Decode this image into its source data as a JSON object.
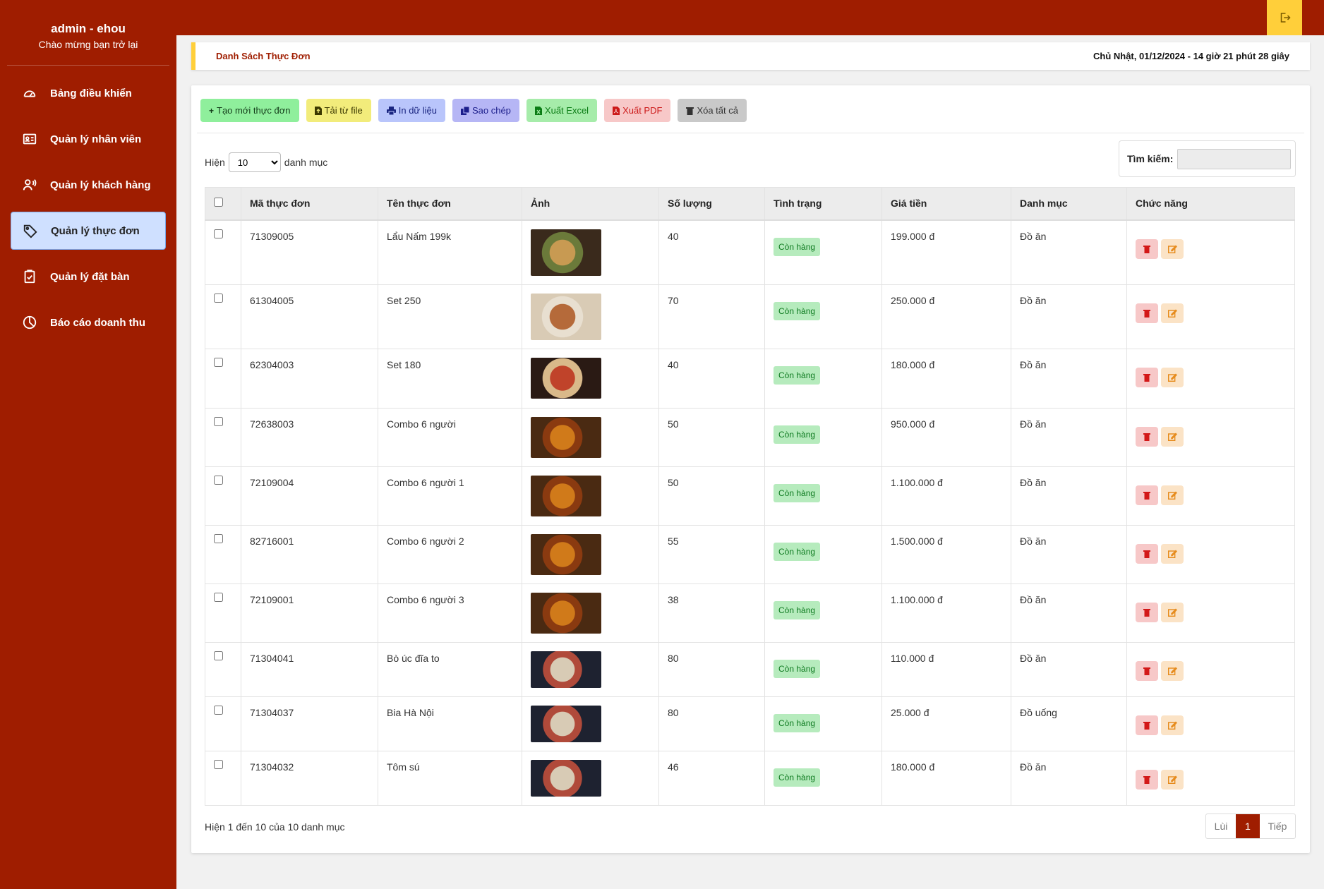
{
  "user": {
    "name": "admin - ehou",
    "welcome": "Chào mừng bạn trở lại"
  },
  "sidebar": {
    "items": [
      {
        "label": "Bảng điều khiển",
        "icon": "gauge-icon",
        "active": false
      },
      {
        "label": "Quản lý nhân viên",
        "icon": "id-card-icon",
        "active": false
      },
      {
        "label": "Quản lý khách hàng",
        "icon": "user-voice-icon",
        "active": false
      },
      {
        "label": "Quản lý thực đơn",
        "icon": "tag-icon",
        "active": true
      },
      {
        "label": "Quản lý đặt bàn",
        "icon": "clipboard-check-icon",
        "active": false
      },
      {
        "label": "Báo cáo doanh thu",
        "icon": "pie-chart-icon",
        "active": false
      }
    ]
  },
  "header": {
    "title": "Danh Sách Thực Đơn",
    "datetime": "Chủ Nhật, 01/12/2024 - 14 giờ 21 phút 28 giây",
    "logout_icon": "logout-icon"
  },
  "toolbar": {
    "create": "Tạo mới thực đơn",
    "upload": "Tải từ file",
    "print": "In dữ liệu",
    "copy": "Sao chép",
    "excel": "Xuất Excel",
    "pdf": "Xuất PDF",
    "clear": "Xóa tất cả"
  },
  "length_control": {
    "prefix": "Hiện",
    "value": "10",
    "suffix": "danh mục"
  },
  "search": {
    "label": "Tìm kiếm:",
    "value": ""
  },
  "table": {
    "columns": [
      "Mã thực đơn",
      "Tên thực đơn",
      "Ảnh",
      "Số lượng",
      "Tình trạng",
      "Giá tiền",
      "Danh mục",
      "Chức năng"
    ],
    "rows": [
      {
        "code": "71309005",
        "name": "Lẩu Nấm 199k",
        "qty": "40",
        "status": "Còn hàng",
        "price": "199.000 đ",
        "category": "Đồ ăn"
      },
      {
        "code": "61304005",
        "name": "Set 250",
        "qty": "70",
        "status": "Còn hàng",
        "price": "250.000 đ",
        "category": "Đồ ăn"
      },
      {
        "code": "62304003",
        "name": "Set 180",
        "qty": "40",
        "status": "Còn hàng",
        "price": "180.000 đ",
        "category": "Đồ ăn"
      },
      {
        "code": "72638003",
        "name": "Combo 6 người",
        "qty": "50",
        "status": "Còn hàng",
        "price": "950.000 đ",
        "category": "Đồ ăn"
      },
      {
        "code": "72109004",
        "name": "Combo 6 người 1",
        "qty": "50",
        "status": "Còn hàng",
        "price": "1.100.000 đ",
        "category": "Đồ ăn"
      },
      {
        "code": "82716001",
        "name": "Combo 6 người 2",
        "qty": "55",
        "status": "Còn hàng",
        "price": "1.500.000 đ",
        "category": "Đồ ăn"
      },
      {
        "code": "72109001",
        "name": "Combo 6 người 3",
        "qty": "38",
        "status": "Còn hàng",
        "price": "1.100.000 đ",
        "category": "Đồ ăn"
      },
      {
        "code": "71304041",
        "name": "Bò úc đĩa to",
        "qty": "80",
        "status": "Còn hàng",
        "price": "110.000 đ",
        "category": "Đồ ăn"
      },
      {
        "code": "71304037",
        "name": "Bia Hà Nội",
        "qty": "80",
        "status": "Còn hàng",
        "price": "25.000 đ",
        "category": "Đồ uống"
      },
      {
        "code": "71304032",
        "name": "Tôm sú",
        "qty": "46",
        "status": "Còn hàng",
        "price": "180.000 đ",
        "category": "Đồ ăn"
      }
    ]
  },
  "footer": {
    "info": "Hiện 1 đến 10 của 10 danh mục",
    "prev": "Lùi",
    "page": "1",
    "next": "Tiếp"
  },
  "colors": {
    "primary": "#9f1d00",
    "accent": "#ffcf3a",
    "active_bg": "#cfe0ff"
  }
}
